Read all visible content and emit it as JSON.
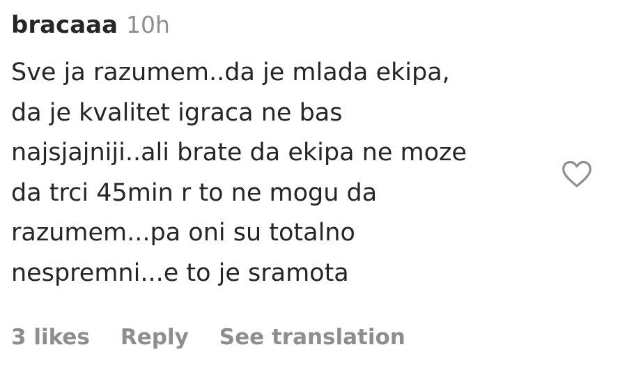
{
  "comment": {
    "username": "bracaaa",
    "time": "10h",
    "lines": [
      "Sve ja razumem..da je mlada ekipa,",
      "da je kvalitet igraca ne bas",
      "najsjajniji..ali brate da ekipa ne moze",
      "da trci 45min r to ne mogu da",
      "razumem...pa oni su totalno",
      "nespremni...e to je sramota"
    ],
    "like_icon": "heart-outline-icon",
    "likes_label": "3 likes",
    "reply_label": "Reply",
    "translation_label": "See translation"
  },
  "colors": {
    "text": "#262626",
    "secondary": "#8e8e8e",
    "background": "#ffffff"
  }
}
